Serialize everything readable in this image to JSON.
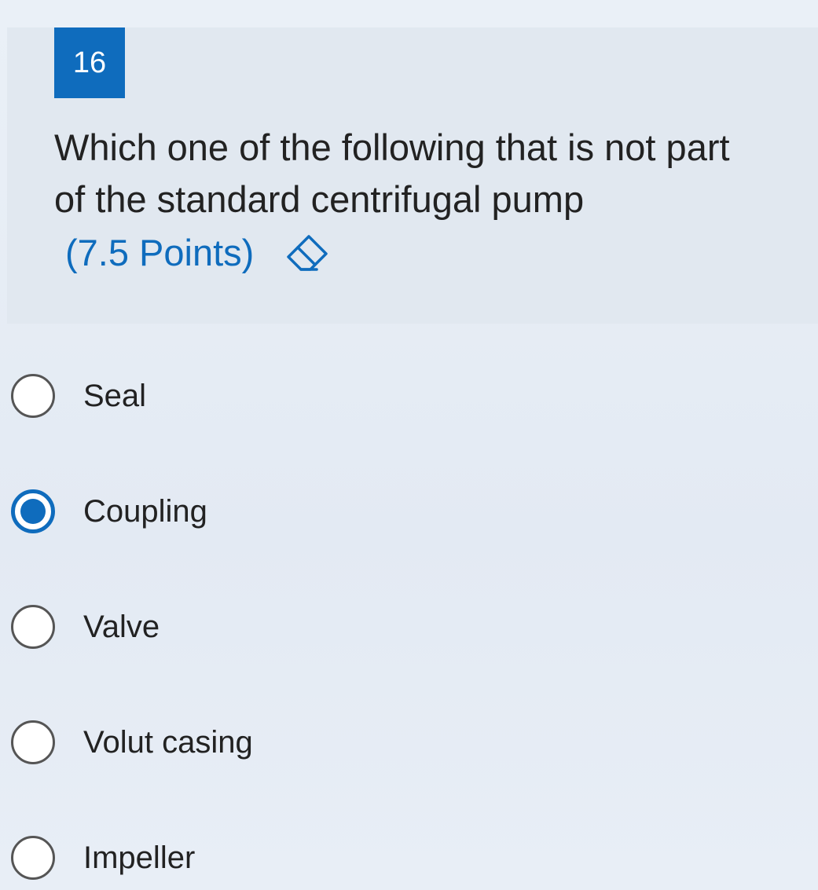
{
  "question": {
    "number": "16",
    "text": "Which one of the following that is not part of the standard centrifugal pump",
    "points": "(7.5 Points)",
    "eraser_icon": "eraser-icon"
  },
  "options": [
    {
      "label": "Seal",
      "selected": false
    },
    {
      "label": "Coupling",
      "selected": true
    },
    {
      "label": "Valve",
      "selected": false
    },
    {
      "label": "Volut casing",
      "selected": false
    },
    {
      "label": "Impeller",
      "selected": false
    }
  ],
  "colors": {
    "accent": "#0f6cbd",
    "text": "#222222",
    "card": "#e1e8f0"
  }
}
